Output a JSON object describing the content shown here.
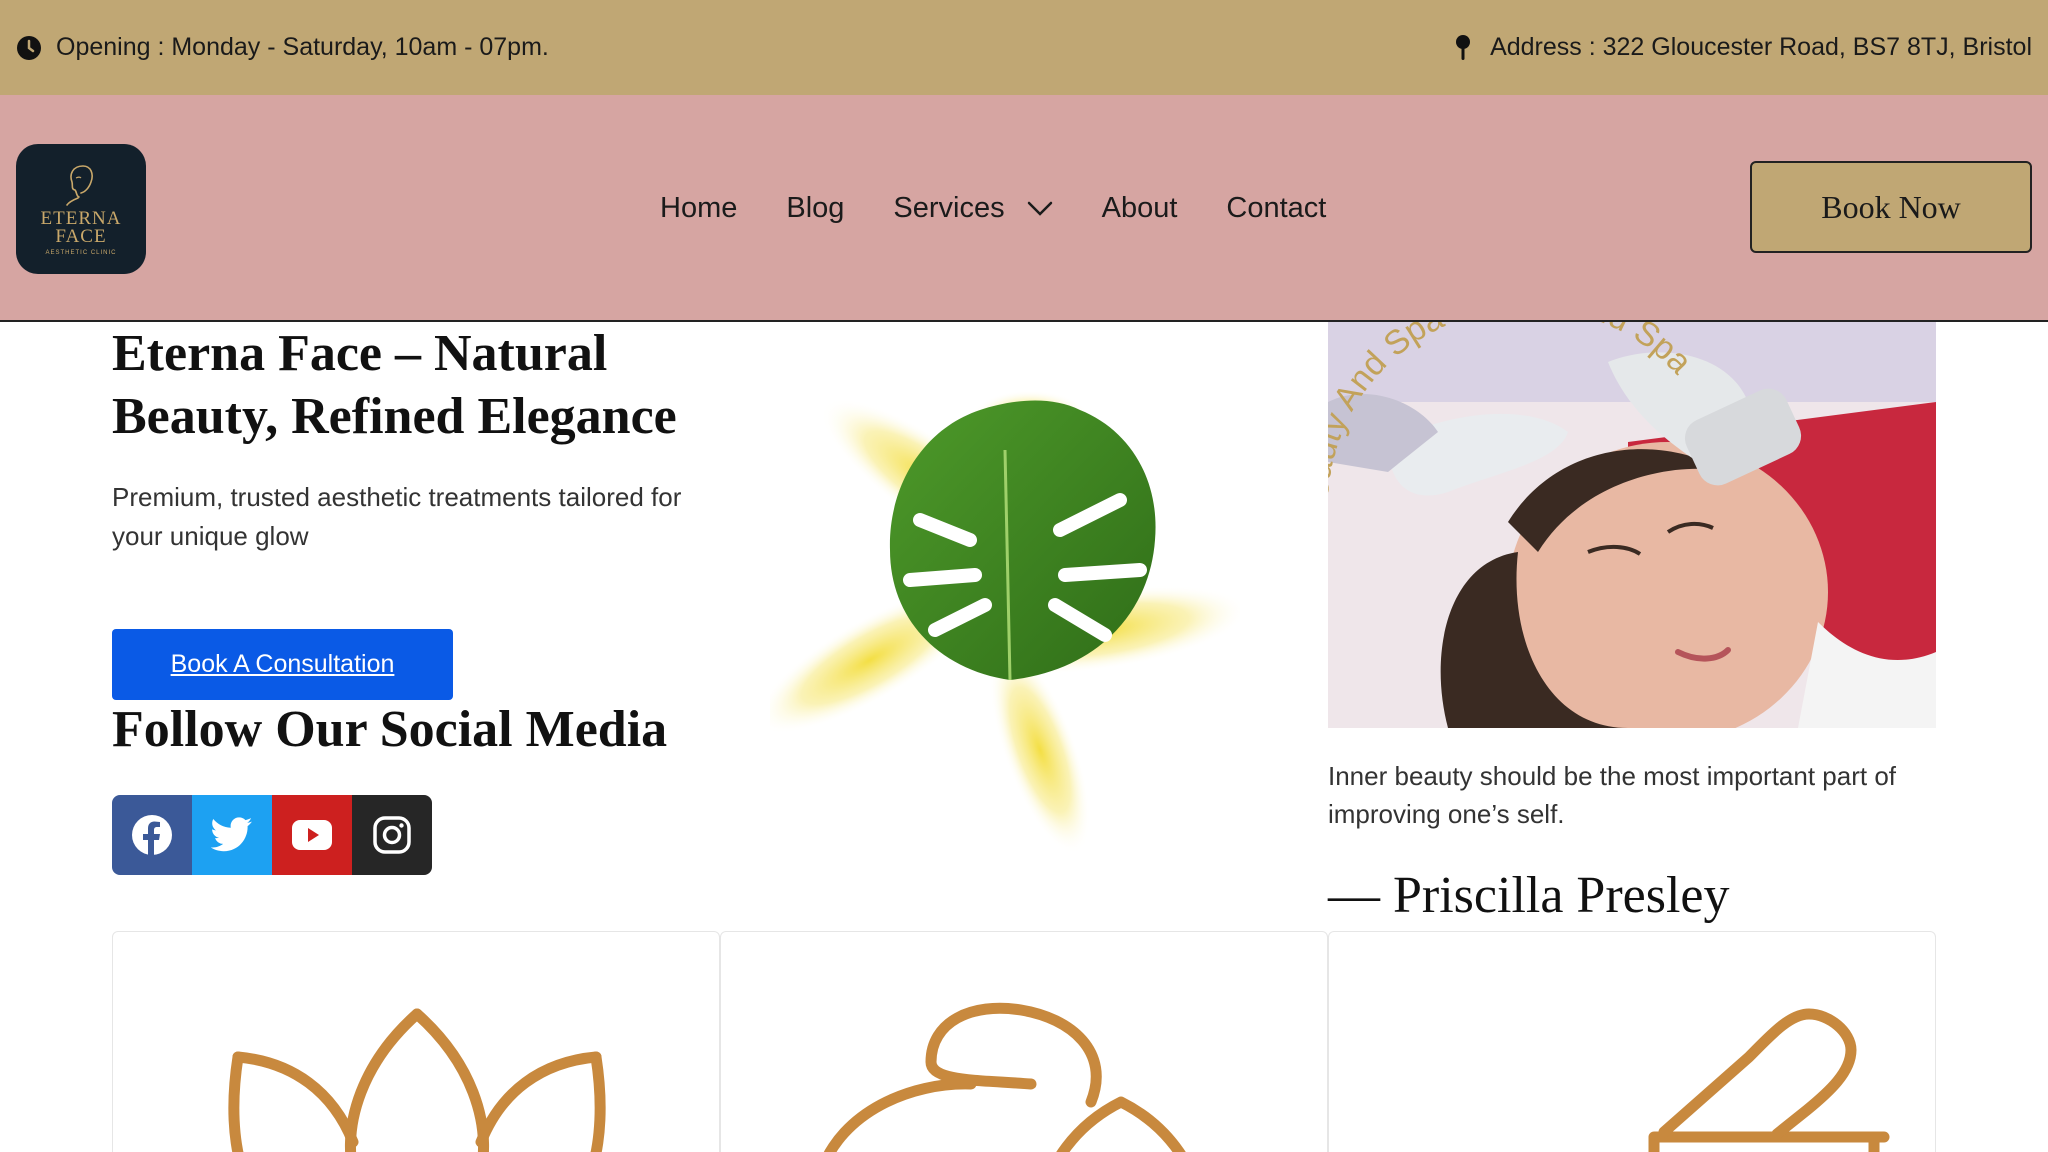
{
  "topbar": {
    "opening": "Opening : Monday - Saturday, 10am - 07pm.",
    "address": "Address : 322 Gloucester Road, BS7 8TJ, Bristol"
  },
  "logo": {
    "line1": "ETERNA",
    "line2": "FACE",
    "line3": "AESTHETIC CLINIC"
  },
  "nav": {
    "items": [
      {
        "label": "Home"
      },
      {
        "label": "Blog"
      },
      {
        "label": "Services"
      },
      {
        "label": "About"
      },
      {
        "label": "Contact"
      }
    ],
    "book_now": "Book Now"
  },
  "hero": {
    "title": "Eterna Face – Natural Beauty, Refined Elegance",
    "subtitle": "Premium, trusted aesthetic treatments tailored for your unique glow",
    "cta": "Book A Consultation",
    "follow_title": "Follow Our Social Media"
  },
  "socials": [
    "facebook-icon",
    "twitter-icon",
    "youtube-icon",
    "instagram-icon"
  ],
  "photo": {
    "arc_text": "Beauty And Spa Beauty And Spa"
  },
  "quote": {
    "text": "Inner beauty should be the most important part of improving one’s self.",
    "author": "— Priscilla Presley"
  },
  "cards": [
    "lotus-icon",
    "stones-icon",
    "mortar-icon"
  ],
  "colors": {
    "topbar": "#c0a774",
    "header": "#d6a5a2",
    "cta": "#0a5ae6",
    "icon_gold": "#c8893e"
  }
}
